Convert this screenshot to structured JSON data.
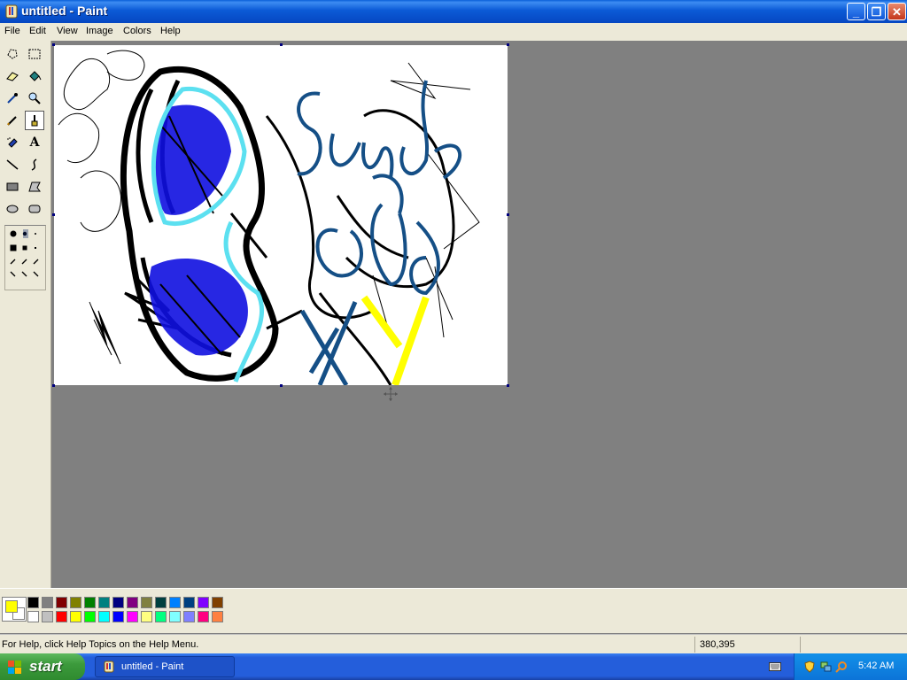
{
  "window": {
    "title": "untitled - Paint"
  },
  "menu": [
    "File",
    "Edit",
    "View",
    "Image",
    "Colors",
    "Help"
  ],
  "tools": [
    {
      "name": "free-form-select-icon"
    },
    {
      "name": "select-icon"
    },
    {
      "name": "eraser-icon"
    },
    {
      "name": "fill-icon"
    },
    {
      "name": "pick-color-icon"
    },
    {
      "name": "magnifier-icon"
    },
    {
      "name": "pencil-icon"
    },
    {
      "name": "brush-icon"
    },
    {
      "name": "airbrush-icon"
    },
    {
      "name": "text-icon"
    },
    {
      "name": "line-icon"
    },
    {
      "name": "curve-icon"
    },
    {
      "name": "rectangle-icon"
    },
    {
      "name": "polygon-icon"
    },
    {
      "name": "ellipse-icon"
    },
    {
      "name": "rounded-rectangle-icon"
    }
  ],
  "text_tool_glyph": "A",
  "selected_tool": "brush-icon",
  "canvas_text": "Sunday Cute XY",
  "palette": {
    "foreground": "#ffff00",
    "background": "#ffffff",
    "row1": [
      "#000000",
      "#808080",
      "#800000",
      "#808000",
      "#008000",
      "#008080",
      "#000080",
      "#800080",
      "#808040",
      "#004040",
      "#0080ff",
      "#004080",
      "#8000ff",
      "#804000"
    ],
    "row2": [
      "#ffffff",
      "#c0c0c0",
      "#ff0000",
      "#ffff00",
      "#00ff00",
      "#00ffff",
      "#0000ff",
      "#ff00ff",
      "#ffff80",
      "#00ff80",
      "#80ffff",
      "#8080ff",
      "#ff0080",
      "#ff8040"
    ]
  },
  "status": {
    "help_text": "For Help, click Help Topics on the Help Menu.",
    "coords": "380,395"
  },
  "taskbar": {
    "start_label": "start",
    "task_label": "untitled - Paint",
    "clock": "5:42 AM"
  }
}
